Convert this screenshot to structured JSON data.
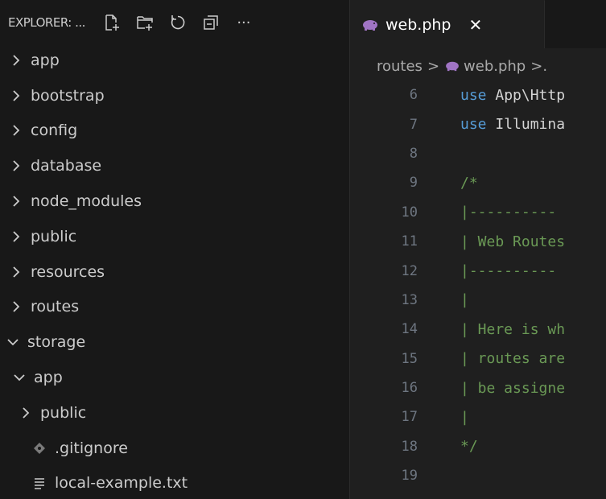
{
  "explorer": {
    "title": "EXPLORER: ...",
    "more_label": "···",
    "tree": [
      {
        "label": "app",
        "type": "folder",
        "expanded": false,
        "level": 0
      },
      {
        "label": "bootstrap",
        "type": "folder",
        "expanded": false,
        "level": 0
      },
      {
        "label": "config",
        "type": "folder",
        "expanded": false,
        "level": 0
      },
      {
        "label": "database",
        "type": "folder",
        "expanded": false,
        "level": 0
      },
      {
        "label": "node_modules",
        "type": "folder",
        "expanded": false,
        "level": 0
      },
      {
        "label": "public",
        "type": "folder",
        "expanded": false,
        "level": 0
      },
      {
        "label": "resources",
        "type": "folder",
        "expanded": false,
        "level": 0
      },
      {
        "label": "routes",
        "type": "folder",
        "expanded": false,
        "level": 0
      },
      {
        "label": "storage",
        "type": "folder",
        "expanded": true,
        "level": 0
      },
      {
        "label": "app",
        "type": "folder",
        "expanded": true,
        "level": 1
      },
      {
        "label": "public",
        "type": "folder",
        "expanded": false,
        "level": 2
      },
      {
        "label": ".gitignore",
        "type": "git-file",
        "level": 2
      },
      {
        "label": "local-example.txt",
        "type": "text-file",
        "level": 2
      }
    ]
  },
  "editor": {
    "tab": {
      "label": "web.php",
      "close": "✕"
    },
    "breadcrumb": {
      "folder": "routes",
      "sep": ">",
      "file": "web.php",
      "tail": ">."
    },
    "lines": [
      {
        "n": "6",
        "kw": "use",
        "text": " App\\Http"
      },
      {
        "n": "7",
        "kw": "use",
        "text": " Illumina"
      },
      {
        "n": "8",
        "kw": "",
        "text": ""
      },
      {
        "n": "9",
        "kw": "",
        "text": "/*"
      },
      {
        "n": "10",
        "kw": "",
        "text": "|----------"
      },
      {
        "n": "11",
        "kw": "",
        "text": "| Web Routes"
      },
      {
        "n": "12",
        "kw": "",
        "text": "|----------"
      },
      {
        "n": "13",
        "kw": "",
        "text": "|"
      },
      {
        "n": "14",
        "kw": "",
        "text": "| Here is wh"
      },
      {
        "n": "15",
        "kw": "",
        "text": "| routes are"
      },
      {
        "n": "16",
        "kw": "",
        "text": "| be assigne"
      },
      {
        "n": "17",
        "kw": "",
        "text": "|"
      },
      {
        "n": "18",
        "kw": "",
        "text": "*/"
      },
      {
        "n": "19",
        "kw": "",
        "text": ""
      }
    ]
  },
  "colors": {
    "sidebar_bg": "#181818",
    "editor_bg": "#1f1f1f",
    "text": "#cccccc",
    "keyword": "#569cd6",
    "comment": "#6a9955",
    "line_number": "#6e7681",
    "php_icon": "#a074c4"
  },
  "icons": {
    "new_file": "new-file-icon",
    "new_folder": "new-folder-icon",
    "refresh": "refresh-icon",
    "collapse_all": "collapse-all-icon",
    "more": "more-icon",
    "php": "php-elephant-icon",
    "chevron_right": "chevron-right-icon",
    "chevron_down": "chevron-down-icon",
    "git": "git-icon",
    "text_file": "text-file-icon"
  }
}
